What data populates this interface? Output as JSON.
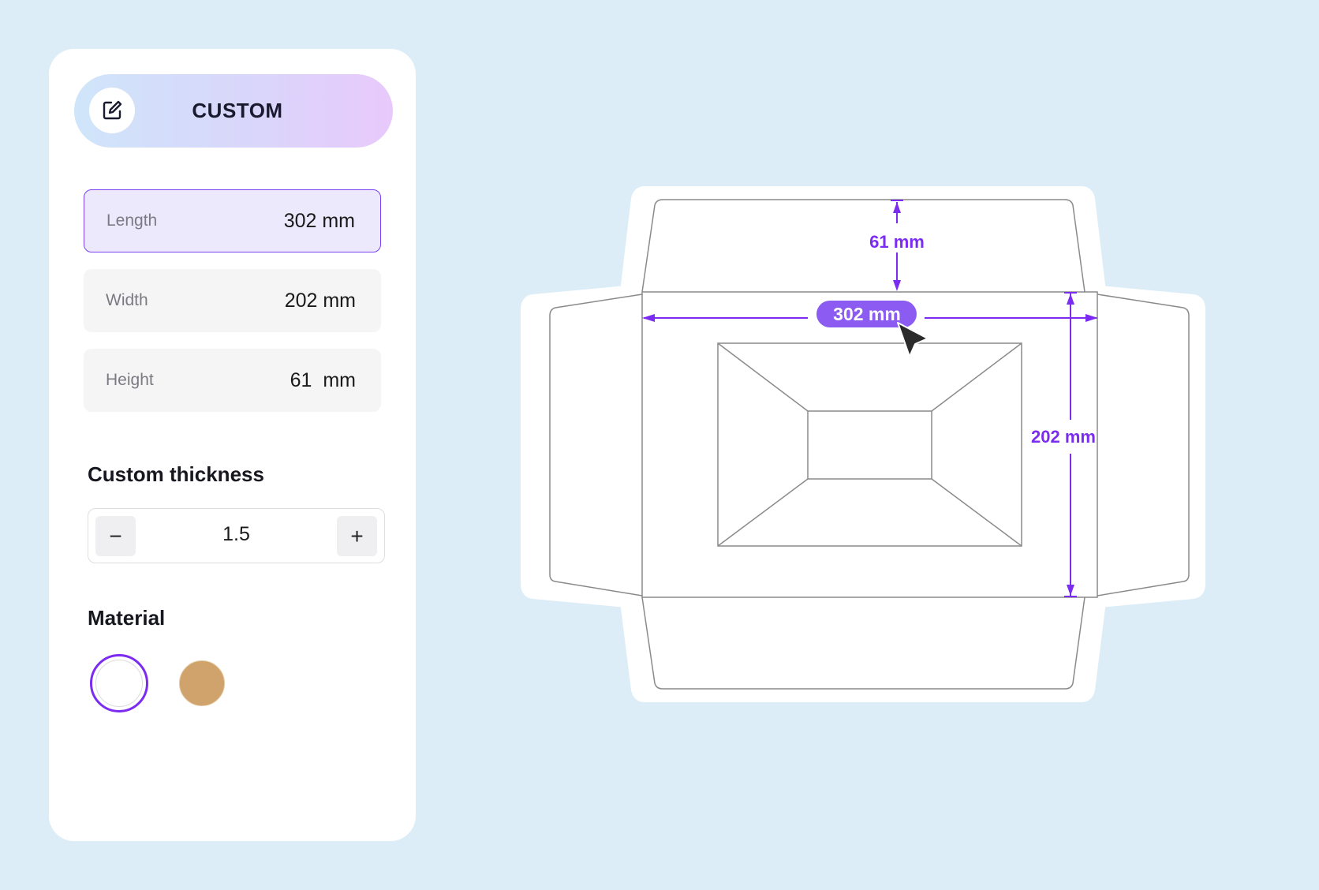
{
  "mode": {
    "label": "CUSTOM",
    "icon": "edit-square-icon"
  },
  "dimensions": [
    {
      "label": "Length",
      "value": "302 mm",
      "active": true
    },
    {
      "label": "Width",
      "value": "202 mm",
      "active": false
    },
    {
      "label": "Height",
      "value": "61  mm",
      "active": false
    }
  ],
  "thickness": {
    "title": "Custom thickness",
    "value": "1.5",
    "decrement_label": "−",
    "increment_label": "+"
  },
  "material": {
    "title": "Material",
    "swatches": [
      {
        "name": "white",
        "color": "#ffffff",
        "selected": true
      },
      {
        "name": "kraft",
        "color": "#cfa36b",
        "selected": false
      }
    ]
  },
  "dieline": {
    "height_dim": "61 mm",
    "length_dim": "302 mm",
    "width_dim": "202 mm",
    "accent_color": "#7b2cf0"
  }
}
